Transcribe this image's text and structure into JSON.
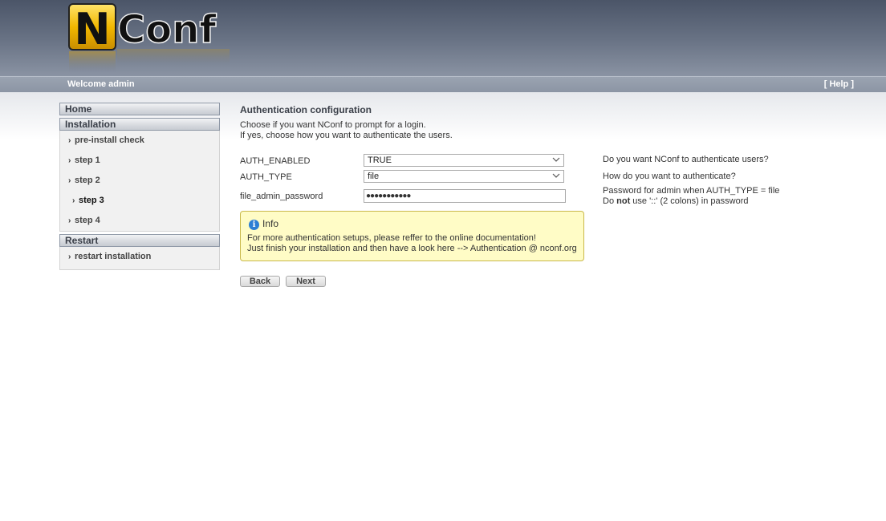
{
  "header": {
    "logo_text": "NConf",
    "welcome": "Welcome admin",
    "help": "[ Help ]"
  },
  "sidebar": {
    "home": "Home",
    "installation": {
      "header": "Installation",
      "items": [
        "pre-install check",
        "step 1",
        "step 2",
        "step 3",
        "step 4"
      ],
      "active": "step 3"
    },
    "restart": {
      "header": "Restart",
      "items": [
        "restart installation"
      ]
    }
  },
  "main": {
    "title": "Authentication configuration",
    "intro_line1": "Choose if you want NConf to prompt for a login.",
    "intro_line2": "If yes, choose how you want to authenticate the users.",
    "fields": [
      {
        "label": "AUTH_ENABLED",
        "value": "TRUE",
        "help": "Do you want NConf to authenticate users?"
      },
      {
        "label": "AUTH_TYPE",
        "value": "file",
        "help": "How do you want to authenticate?"
      },
      {
        "label": "file_admin_password",
        "value": "●●●●●●●●●●●",
        "help_line1": "Password for admin when AUTH_TYPE = file",
        "help_line2_pre": "Do ",
        "help_line2_bold": "not",
        "help_line2_post": " use '::' (2 colons) in password"
      }
    ],
    "info": {
      "title": "Info",
      "line1": "For more authentication setups, please reffer to the online documentation!",
      "line2": "Just finish your installation and then have a look here --> Authentication @ nconf.org"
    },
    "buttons": {
      "back": "Back",
      "next": "Next"
    }
  },
  "colors": {
    "header_top": "#4b5568",
    "info_bg": "#fffcc6",
    "info_border": "#c9b84a",
    "logo_yellow": "#f2b800"
  }
}
